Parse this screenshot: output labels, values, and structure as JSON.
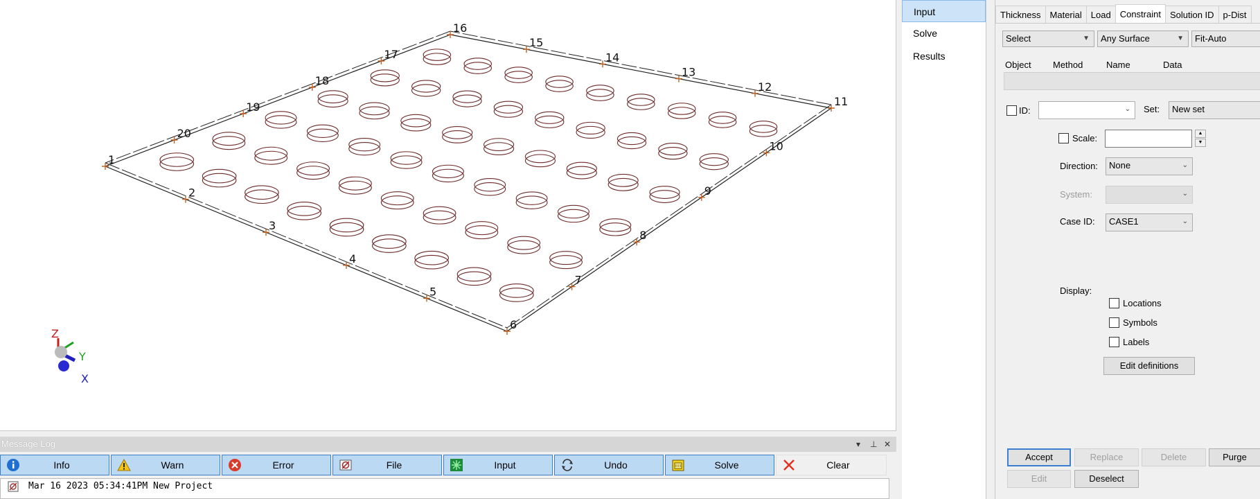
{
  "viewport": {
    "node_labels": [
      "1",
      "2",
      "3",
      "4",
      "5",
      "6",
      "7",
      "8",
      "9",
      "10",
      "11",
      "12",
      "13",
      "14",
      "15",
      "16",
      "17",
      "18",
      "19",
      "20"
    ],
    "axis": {
      "z": "Z",
      "y": "Y",
      "x": "X"
    }
  },
  "message_log": {
    "title": "Message Log",
    "window_controls": {
      "dropdown": "▾",
      "pin": "⊥",
      "close": "✕"
    },
    "buttons": [
      {
        "label": "Info",
        "icon": "info-icon"
      },
      {
        "label": "Warn",
        "icon": "warning-icon"
      },
      {
        "label": "Error",
        "icon": "error-icon"
      },
      {
        "label": "File",
        "icon": "file-icon"
      },
      {
        "label": "Input",
        "icon": "input-icon"
      },
      {
        "label": "Undo",
        "icon": "undo-icon"
      },
      {
        "label": "Solve",
        "icon": "solve-icon"
      },
      {
        "label": "Clear",
        "icon": "clear-icon"
      }
    ],
    "lines": [
      "Mar 16 2023 05:34:41PM   New Project"
    ]
  },
  "nav": {
    "items": [
      "Input",
      "Solve",
      "Results"
    ],
    "active": "Input"
  },
  "panel": {
    "tabs": [
      "Thickness",
      "Material",
      "Load",
      "Constraint",
      "Solution ID",
      "p-Dist"
    ],
    "active_tab": "Constraint",
    "select_mode": "Select",
    "surface_filter": "Any Surface",
    "fit_mode": "Fit-Auto",
    "table_headers": [
      "Object",
      "Method",
      "Name",
      "Data"
    ],
    "id_label": "ID:",
    "id_value": "",
    "set_label": "Set:",
    "set_value": "New set",
    "scale_label": "Scale:",
    "scale_value": "",
    "direction_label": "Direction:",
    "direction_value": "None",
    "system_label": "System:",
    "system_value": "",
    "case_label": "Case ID:",
    "case_value": "CASE1",
    "display_label": "Display:",
    "display_options": [
      "Locations",
      "Symbols",
      "Labels"
    ],
    "edit_definitions": "Edit definitions",
    "actions": {
      "accept": "Accept",
      "replace": "Replace",
      "delete": "Delete",
      "purge": "Purge",
      "edit": "Edit",
      "deselect": "Deselect"
    }
  },
  "colors": {
    "accent": "#3c7fc4",
    "button_fill": "#bcd9f4",
    "model_lines": "#222222",
    "circles": "#6e2a2a",
    "node_marker": "#c06020"
  }
}
